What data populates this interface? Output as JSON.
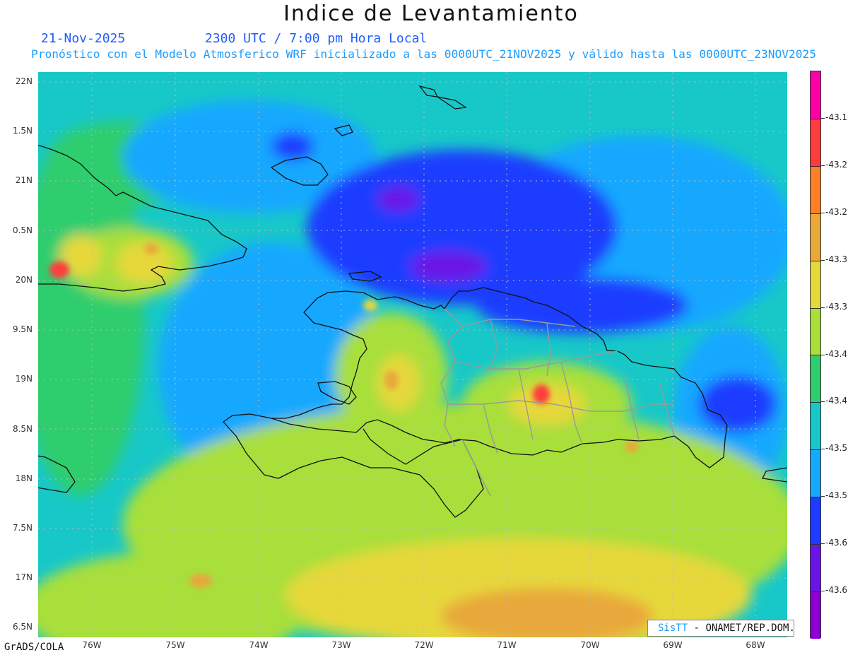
{
  "header": {
    "title": "Indice de Levantamiento",
    "date": "21-Nov-2025",
    "time": "2300 UTC / 7:00 pm Hora Local",
    "description": "Pronóstico con el Modelo Atmosferico WRF inicializado a las 0000UTC_21NOV2025 y válido hasta las  0000UTC_23NOV2025"
  },
  "axes": {
    "lat_labels": [
      "22N",
      "1.5N",
      "21N",
      "0.5N",
      "20N",
      "9.5N",
      "19N",
      "8.5N",
      "18N",
      "7.5N",
      "17N",
      "6.5N"
    ],
    "lon_labels": [
      "76W",
      "75W",
      "74W",
      "73W",
      "72W",
      "71W",
      "70W",
      "69W",
      "68W"
    ]
  },
  "colorbar": {
    "colors": [
      "#ff00a8",
      "#ff3c3c",
      "#ff7f24",
      "#e8a83a",
      "#e6d83a",
      "#a8df3a",
      "#2fcd6e",
      "#18c8c8",
      "#18a8ff",
      "#1e3cff",
      "#6a14e6",
      "#8c00d2"
    ],
    "labels": [
      "-43.1",
      "-43.2",
      "-43.2",
      "-43.3",
      "-43.3",
      "-43.4",
      "-43.4",
      "-43.5",
      "-43.5",
      "-43.6",
      "-43.6"
    ]
  },
  "footer": {
    "software": "GrADS/COLA",
    "credit_brand": "SisTT",
    "credit_text": "- ONAMET/REP.DOM."
  }
}
